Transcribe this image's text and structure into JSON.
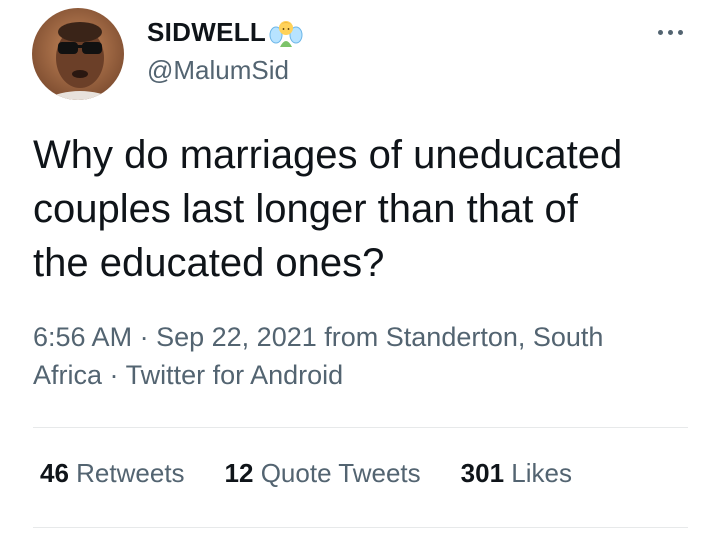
{
  "author": {
    "display_name": "SIDWELL",
    "handle": "@MalumSid",
    "name_emoji": "fairy-emoji"
  },
  "tweet": {
    "text": "Why do marriages of uneducated\ncouples last longer than that of\nthe educated ones?",
    "time": "6:56 AM",
    "date": "Sep 22, 2021",
    "location_prefix": "from",
    "location": "Standerton, South Africa",
    "source": "Twitter for Android",
    "separator": "·"
  },
  "stats": {
    "retweets": {
      "count": "46",
      "label": "Retweets"
    },
    "quote_tweets": {
      "count": "12",
      "label": "Quote Tweets"
    },
    "likes": {
      "count": "301",
      "label": "Likes"
    }
  },
  "icons": {
    "more": "more-options-icon"
  },
  "colors": {
    "text_primary": "#0f1419",
    "text_secondary": "#536471",
    "divider": "#e7e9ea"
  }
}
